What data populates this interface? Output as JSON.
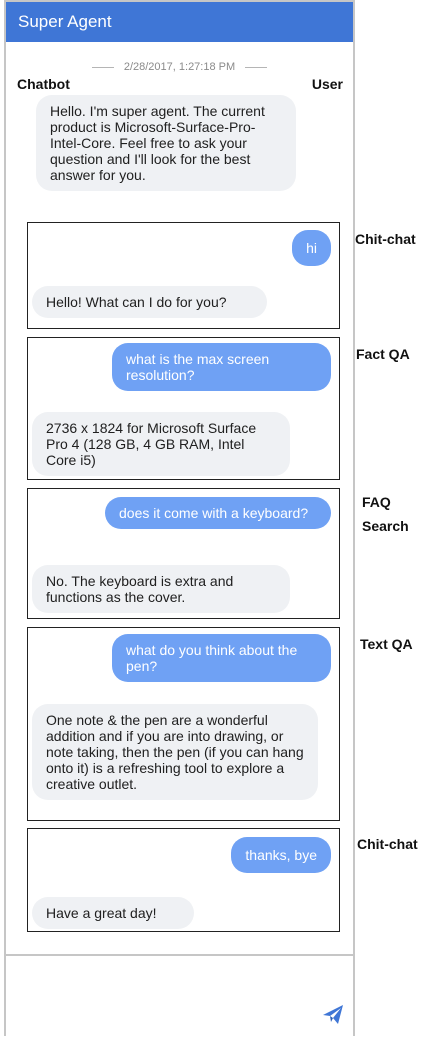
{
  "app": {
    "title": "Super Agent"
  },
  "chat": {
    "timestamp": "2/28/2017, 1:27:18 PM",
    "label_bot": "Chatbot",
    "label_user": "User",
    "welcome": "Hello. I'm super agent. The current product is Microsoft-Surface-Pro-Intel-Core. Feel free to ask your question and I'll look for the best answer for you.",
    "turns": [
      {
        "user": "hi",
        "bot": "Hello! What can I do for you?",
        "category": "Chit-chat"
      },
      {
        "user": "what is the max screen resolution?",
        "bot": "2736 x 1824 for Microsoft Surface Pro 4 (128 GB, 4 GB RAM, Intel Core i5)",
        "category": "Fact QA"
      },
      {
        "user": "does it come with a keyboard?",
        "bot": "No. The keyboard is extra and functions as the cover.",
        "category_line1": "FAQ",
        "category_line2": "Search"
      },
      {
        "user": "what do you think about the pen?",
        "bot": "One note & the pen are a wonderful addition and if you are into drawing, or note taking, then the pen (if you can hang onto it) is a refreshing tool to explore a creative outlet.",
        "category": "Text QA"
      },
      {
        "user": "thanks, bye",
        "bot": "Have a great day!",
        "category": "Chit-chat"
      }
    ]
  },
  "input": {
    "send_icon": "send-icon",
    "accent_color": "#3f76d6"
  },
  "colors": {
    "header": "#3f76d6",
    "user_bubble": "#6fa1f4",
    "bot_bubble": "#eff1f4"
  }
}
